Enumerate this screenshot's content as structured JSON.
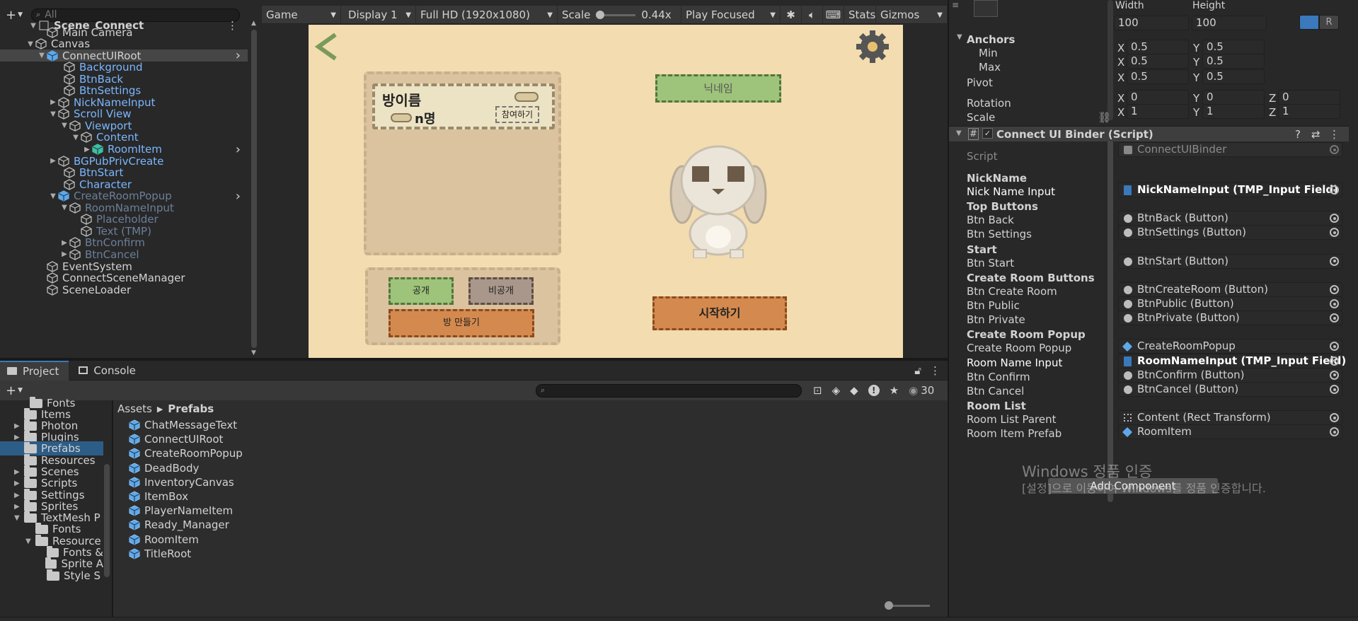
{
  "hierarchy": {
    "search_placeholder": "All",
    "scene": "Scene_Connect",
    "items": [
      {
        "label": "Main Camera"
      },
      {
        "label": "Canvas"
      },
      {
        "label": "ConnectUIRoot"
      },
      {
        "label": "Background"
      },
      {
        "label": "BtnBack"
      },
      {
        "label": "BtnSettings"
      },
      {
        "label": "NickNameInput"
      },
      {
        "label": "Scroll View"
      },
      {
        "label": "Viewport"
      },
      {
        "label": "Content"
      },
      {
        "label": "RoomItem"
      },
      {
        "label": "BGPubPrivCreate"
      },
      {
        "label": "BtnStart"
      },
      {
        "label": "Character"
      },
      {
        "label": "CreateRoomPopup"
      },
      {
        "label": "RoomNameInput"
      },
      {
        "label": "Placeholder"
      },
      {
        "label": "Text (TMP)"
      },
      {
        "label": "BtnConfirm"
      },
      {
        "label": "BtnCancel"
      },
      {
        "label": "EventSystem"
      },
      {
        "label": "ConnectSceneManager"
      },
      {
        "label": "SceneLoader"
      }
    ]
  },
  "game_toolbar": {
    "view": "Game",
    "display": "Display 1",
    "resolution": "Full HD (1920x1080)",
    "scale_label": "Scale",
    "scale_value": "0.44x",
    "play_mode": "Play Focused",
    "stats": "Stats",
    "gizmos": "Gizmos"
  },
  "game_canvas": {
    "room_name": "방이름",
    "people": "n명",
    "join": "참여하기",
    "nickname": "닉네임",
    "public": "공개",
    "private": "비공개",
    "create_room": "방 만들기",
    "start": "시작하기"
  },
  "project": {
    "tab_project": "Project",
    "tab_console": "Console",
    "breadcrumb_root": "Assets",
    "breadcrumb_current": "Prefabs",
    "hidden_count": "30",
    "folders": [
      "Fonts",
      "Items",
      "Photon",
      "Plugins",
      "Prefabs",
      "Resources",
      "Scenes",
      "Scripts",
      "Settings",
      "Sprites",
      "TextMesh P",
      "Fonts",
      "Resource",
      "Fonts &",
      "Sprite A",
      "Style S"
    ],
    "assets": [
      "ChatMessageText",
      "ConnectUIRoot",
      "CreateRoomPopup",
      "DeadBody",
      "InventoryCanvas",
      "ItemBox",
      "PlayerNameItem",
      "Ready_Manager",
      "RoomItem",
      "TitleRoot"
    ]
  },
  "inspector": {
    "width_label": "Width",
    "height_label": "Height",
    "width": "100",
    "height": "100",
    "anchors": "Anchors",
    "min": "Min",
    "max": "Max",
    "pivot": "Pivot",
    "rotation": "Rotation",
    "scale": "Scale",
    "min_x": "0.5",
    "min_y": "0.5",
    "max_x": "0.5",
    "max_y": "0.5",
    "pivot_x": "0.5",
    "pivot_y": "0.5",
    "rot_x": "0",
    "rot_y": "0",
    "rot_z": "0",
    "scale_x": "1",
    "scale_y": "1",
    "scale_z": "1",
    "component": "Connect UI Binder (Script)",
    "script_label": "Script",
    "script_value": "ConnectUIBinder",
    "fields": [
      {
        "section": "NickName"
      },
      {
        "label": "Nick Name Input",
        "value": "NickNameInput (TMP_Input Field)",
        "icon": "input-icon",
        "bold": true
      },
      {
        "section": "Top Buttons"
      },
      {
        "label": "Btn Back",
        "value": "BtnBack (Button)",
        "icon": "dot-icon"
      },
      {
        "label": "Btn Settings",
        "value": "BtnSettings (Button)",
        "icon": "dot-icon"
      },
      {
        "section": "Start"
      },
      {
        "label": "Btn Start",
        "value": "BtnStart (Button)",
        "icon": "dot-icon"
      },
      {
        "section": "Create Room Buttons"
      },
      {
        "label": "Btn Create Room",
        "value": "BtnCreateRoom (Button)",
        "icon": "dot-icon"
      },
      {
        "label": "Btn Public",
        "value": "BtnPublic (Button)",
        "icon": "dot-icon"
      },
      {
        "label": "Btn Private",
        "value": "BtnPrivate (Button)",
        "icon": "dot-icon"
      },
      {
        "section": "Create Room Popup"
      },
      {
        "label": "Create Room Popup",
        "value": "CreateRoomPopup",
        "icon": "prefab-icon"
      },
      {
        "label": "Room Name Input",
        "value": "RoomNameInput (TMP_Input Field)",
        "icon": "input-icon",
        "bold": true
      },
      {
        "label": "Btn Confirm",
        "value": "BtnConfirm (Button)",
        "icon": "dot-icon"
      },
      {
        "label": "Btn Cancel",
        "value": "BtnCancel (Button)",
        "icon": "dot-icon"
      },
      {
        "section": "Room List"
      },
      {
        "label": "Room List Parent",
        "value": "Content (Rect Transform)",
        "icon": "rect-icon"
      },
      {
        "label": "Room Item Prefab",
        "value": "RoomItem",
        "icon": "prefab-icon"
      }
    ],
    "add_component": "Add Component",
    "watermark_title": "Windows 정품 인증",
    "watermark_text": "[설정]으로 이동하여 Windows를 정품 인증합니다."
  },
  "colors": {
    "accent": "#2c5d87",
    "prefab": "#7bb6ff",
    "canvas_bg": "#f2dcb0"
  }
}
